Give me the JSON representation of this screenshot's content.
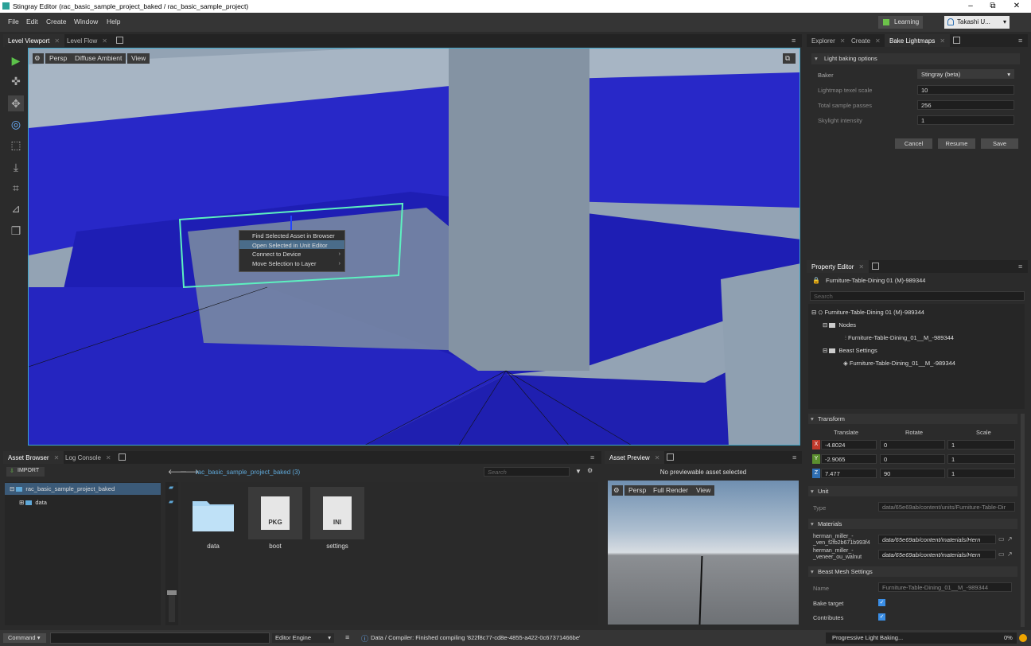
{
  "window": {
    "title": "Stingray Editor (rac_basic_sample_project_baked / rac_basic_sample_project)",
    "min": "–",
    "max": "⧉",
    "close": "✕"
  },
  "menu": [
    "File",
    "Edit",
    "Create",
    "Window",
    "Help"
  ],
  "learning": "Learning",
  "user": "Takashi U...",
  "viewport_tabs": [
    "Level Viewport",
    "Level Flow"
  ],
  "viewport_bar": {
    "persp": "Persp",
    "mode": "Diffuse Ambient",
    "view": "View"
  },
  "context_menu": [
    "Find Selected Asset in Browser",
    "Open Selected in Unit Editor",
    "Connect to Device",
    "Move Selection to Layer"
  ],
  "right_tabs": [
    "Explorer",
    "Create",
    "Bake Lightmaps"
  ],
  "light_baking": {
    "title": "Light baking options",
    "baker_label": "Baker",
    "baker_value": "Stingray (beta)",
    "texel_label": "Lightmap texel scale",
    "texel_value": "10",
    "passes_label": "Total sample passes",
    "passes_value": "256",
    "sky_label": "Skylight intensity",
    "sky_value": "1",
    "cancel": "Cancel",
    "resume": "Resume",
    "save": "Save"
  },
  "property": {
    "tab": "Property Editor",
    "name": "Furniture-Table-Dining 01 (M)-989344",
    "search": "Search",
    "tree_root": "Furniture-Table-Dining 01 (M)-989344",
    "nodes": "Nodes",
    "node1": "Furniture-Table-Dining_01__M_-989344",
    "beast": "Beast Settings",
    "beast1": "Furniture-Table-Dining_01__M_-989344",
    "transform": "Transform",
    "translate": "Translate",
    "rotate": "Rotate",
    "scale": "Scale",
    "tx": "-4.8024",
    "ty": "-2.9065",
    "tz": "7.477",
    "rx": "0",
    "ry": "0",
    "rz": "90",
    "sx": "1",
    "sy": "1",
    "sz": "1",
    "unit": "Unit",
    "type_label": "Type",
    "type_value": "data/65e69ab/content/units/Furniture-Table-Dir",
    "materials": "Materials",
    "m1_label": "herman_miller_-_ven_f2fb2b671b993f4",
    "m1_value": "data/65e69ab/content/materials/Hern",
    "m2_label": "herman_miller_-_veneer_ou_walnut",
    "m2_value": "data/65e69ab/content/materials/Hern",
    "beast_mesh": "Beast Mesh Settings",
    "name_label": "Name",
    "name_value": "Furniture-Table-Dining_01__M_-989344",
    "bake_target": "Bake target",
    "contributes": "Contributes"
  },
  "asset_browser": {
    "tabs": [
      "Asset Browser",
      "Log Console"
    ],
    "import": "IMPORT",
    "root": "rac_basic_sample_project_baked",
    "child": "data",
    "breadcrumb": "rac_basic_sample_project_baked (3)",
    "search": "Search",
    "items": [
      {
        "name": "data",
        "tag": ""
      },
      {
        "name": "boot",
        "tag": "PKG"
      },
      {
        "name": "settings",
        "tag": "INI"
      }
    ]
  },
  "asset_preview": {
    "tab": "Asset Preview",
    "msg": "No previewable asset selected",
    "persp": "Persp",
    "render": "Full Render",
    "view": "View"
  },
  "status": {
    "command": "Command",
    "engine": "Editor Engine",
    "message": "Data / Compiler: Finished compiling '822f8c77-cd8e-4855-a422-0c67371466be'",
    "baking": "Progressive Light Baking...",
    "pct": "0%"
  }
}
